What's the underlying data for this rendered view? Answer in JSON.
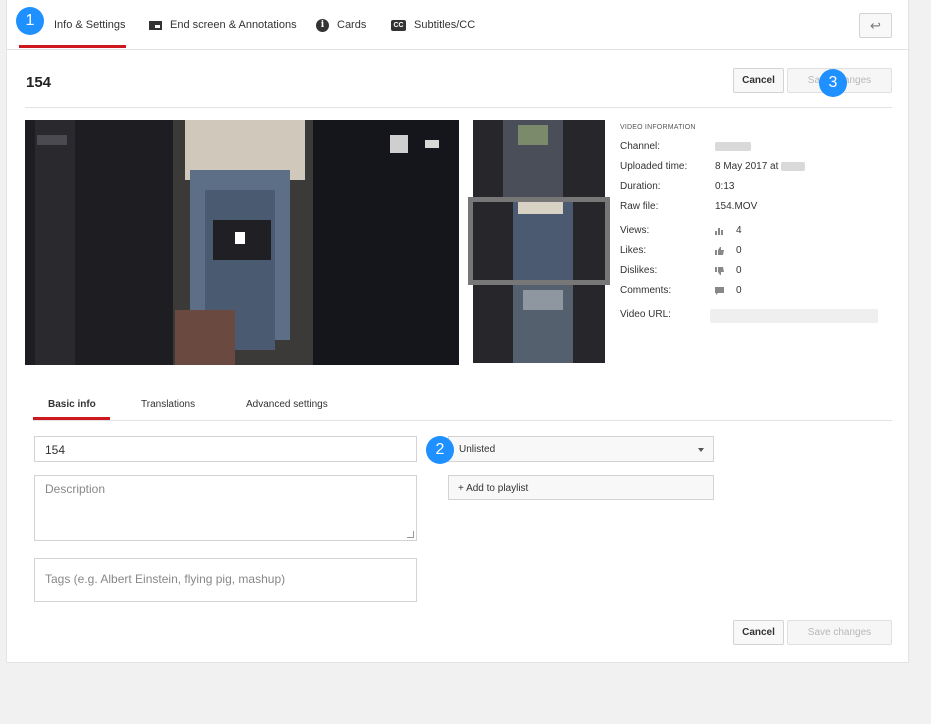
{
  "tabs": [
    {
      "label": "Info & Settings",
      "icon": "none"
    },
    {
      "label": "End screen & Annotations",
      "icon": "end-screen-icon"
    },
    {
      "label": "Cards",
      "icon": "info-icon"
    },
    {
      "label": "Subtitles/CC",
      "icon": "cc-icon"
    }
  ],
  "back_icon": "↩",
  "header": {
    "title": "154",
    "cancel_label": "Cancel",
    "save_label": "Save changes"
  },
  "video_info": {
    "heading": "VIDEO INFORMATION",
    "channel_label": "Channel:",
    "uploaded_label": "Uploaded time:",
    "uploaded_value": "8 May 2017 at",
    "duration_label": "Duration:",
    "duration_value": "0:13",
    "raw_file_label": "Raw file:",
    "raw_file_value": "154.MOV",
    "views_label": "Views:",
    "views_value": "4",
    "likes_label": "Likes:",
    "likes_value": "0",
    "dislikes_label": "Dislikes:",
    "dislikes_value": "0",
    "comments_label": "Comments:",
    "comments_value": "0",
    "url_label": "Video URL:"
  },
  "sub_tabs": [
    "Basic info",
    "Translations",
    "Advanced settings"
  ],
  "form": {
    "title_value": "154",
    "description_placeholder": "Description",
    "tags_placeholder": "Tags (e.g. Albert Einstein, flying pig, mashup)",
    "privacy_value": "Unlisted",
    "add_playlist_label": "+ Add to playlist"
  },
  "footer": {
    "cancel_label": "Cancel",
    "save_label": "Save changes"
  },
  "markers": [
    "1",
    "2",
    "3"
  ],
  "colors": {
    "accent": "#cc181e",
    "marker": "#1e90ff"
  }
}
